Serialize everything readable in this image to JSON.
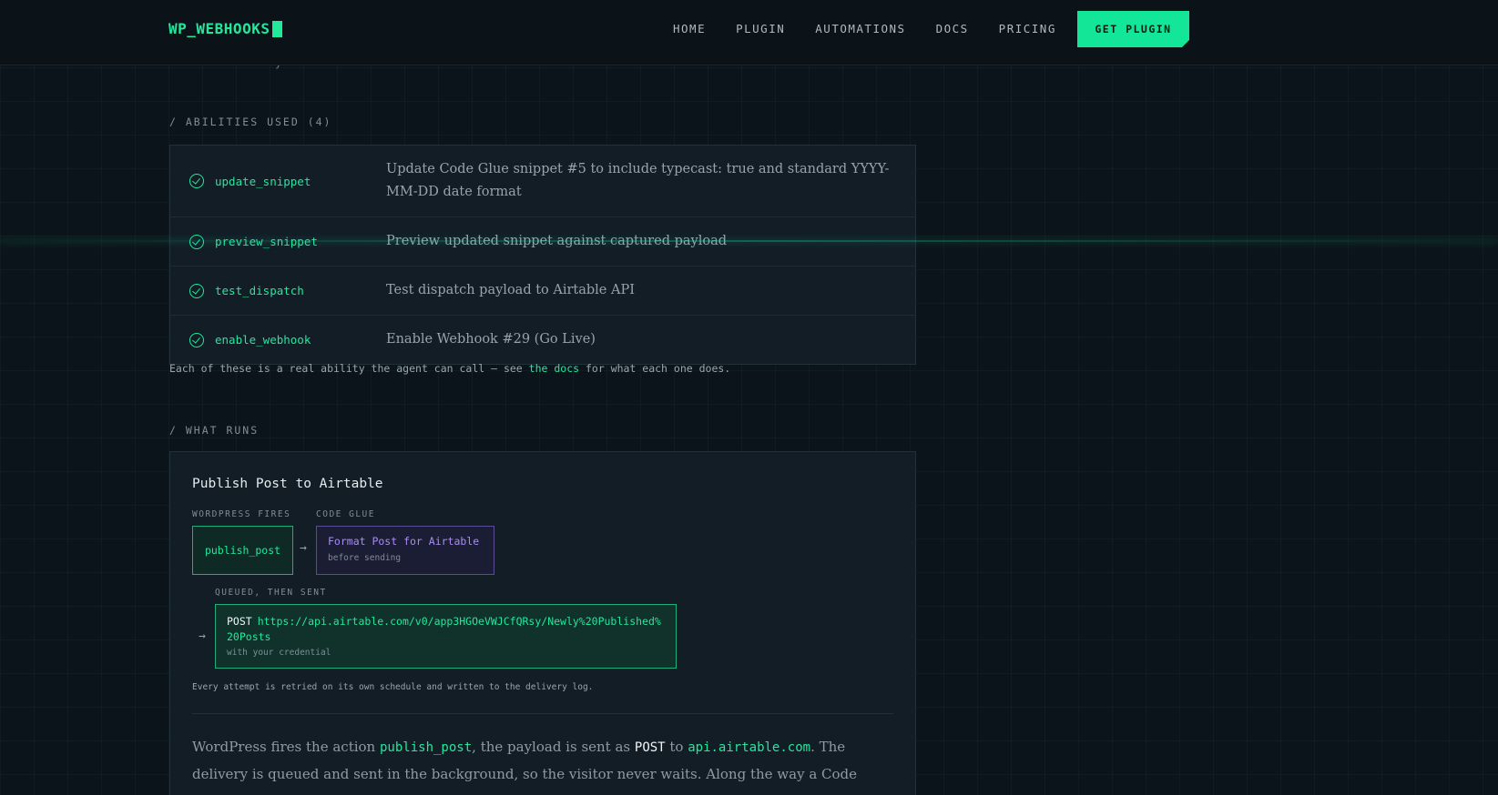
{
  "header": {
    "logo": "WP_WEBHOOKS",
    "nav": [
      "HOME",
      "PLUGIN",
      "AUTOMATIONS",
      "DOCS",
      "PRICING"
    ],
    "cta": "GET PLUGIN"
  },
  "top_partial": "y",
  "abilities": {
    "label": "/ ABILITIES USED (4)",
    "items": [
      {
        "name": "update_snippet",
        "desc": "Update Code Glue snippet #5 to include typecast: true and standard YYYY-MM-DD date format"
      },
      {
        "name": "preview_snippet",
        "desc": "Preview updated snippet against captured payload"
      },
      {
        "name": "test_dispatch",
        "desc": "Test dispatch payload to Airtable API"
      },
      {
        "name": "enable_webhook",
        "desc": "Enable Webhook #29 (Go Live)"
      }
    ],
    "note_before": "Each of these is a real ability the agent can call — see ",
    "note_link": "the docs",
    "note_after": " for what each one does."
  },
  "runs": {
    "label": "/ WHAT RUNS",
    "title": "Publish Post to Airtable",
    "fires_label": "WORDPRESS FIRES",
    "fires_action": "publish_post",
    "glue_label": "CODE GLUE",
    "glue_title": "Format Post for Airtable",
    "glue_sub": "before sending",
    "queued_label": "QUEUED, THEN SENT",
    "method": "POST",
    "url": "https://api.airtable.com/v0/app3HGOeVWJCfQRsy/Newly%20Published%20Posts",
    "credential": "with your credential",
    "retry": "Every attempt is retried on its own schedule and written to the delivery log.",
    "para": {
      "p1": "WordPress fires the action ",
      "action": "publish_post",
      "p2": ", the payload is sent as ",
      "method": "POST",
      "p3": " to ",
      "host": "api.airtable.com",
      "p4": ". The delivery is queued and sent in the background, so the visitor never waits. Along the way a Code Glue snippet shapes the"
    }
  },
  "colors": {
    "accent": "#22e89c",
    "glue": "#a98cf4",
    "background": "#0c141b"
  }
}
